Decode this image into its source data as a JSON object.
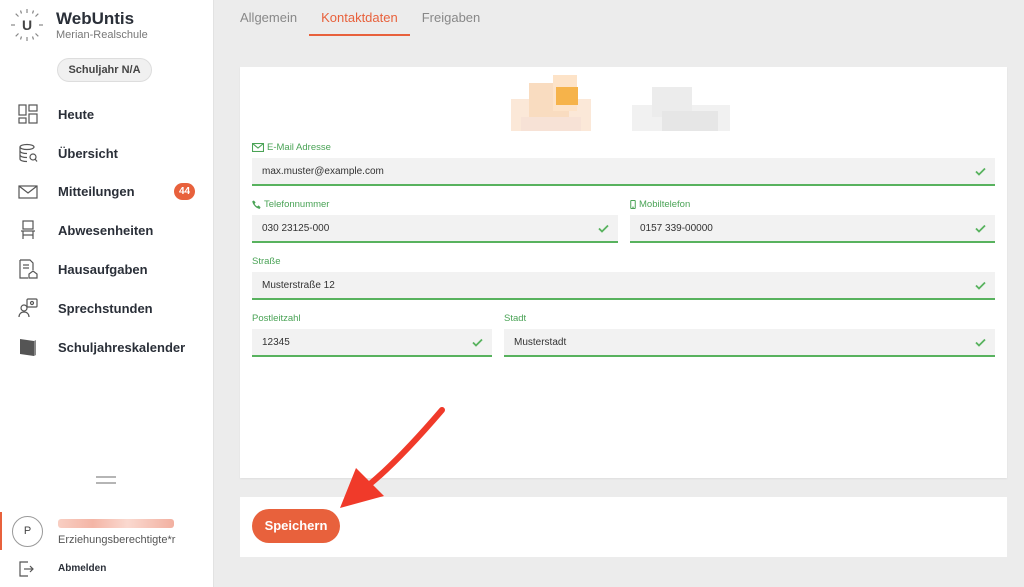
{
  "app": {
    "title": "WebUntis",
    "school": "Merian-Realschule",
    "year": "Schuljahr N/A"
  },
  "nav": [
    {
      "label": "Heute",
      "icon": "dashboard-icon"
    },
    {
      "label": "Übersicht",
      "icon": "overview-icon"
    },
    {
      "label": "Mitteilungen",
      "icon": "mail-icon",
      "badge": "44"
    },
    {
      "label": "Abwesenheiten",
      "icon": "chair-icon"
    },
    {
      "label": "Hausaufgaben",
      "icon": "homework-icon"
    },
    {
      "label": "Sprechstunden",
      "icon": "consultation-icon"
    },
    {
      "label": "Schuljahreskalender",
      "icon": "calendar-icon"
    }
  ],
  "user": {
    "initial": "P",
    "role": "Erziehungsberechtigte*r",
    "logout": "Abmelden"
  },
  "tabs": [
    {
      "label": "Allgemein",
      "active": false
    },
    {
      "label": "Kontaktdaten",
      "active": true
    },
    {
      "label": "Freigaben",
      "active": false
    }
  ],
  "form": {
    "email": {
      "label": "E-Mail Adresse",
      "value": "max.muster@example.com"
    },
    "phone": {
      "label": "Telefonnummer",
      "value": "030 23125-000"
    },
    "mobile": {
      "label": "Mobiltelefon",
      "value": "0157 339-00000"
    },
    "street": {
      "label": "Straße",
      "value": "Musterstraße 12"
    },
    "zip": {
      "label": "Postleitzahl",
      "value": "12345"
    },
    "city": {
      "label": "Stadt",
      "value": "Musterstadt"
    }
  },
  "save_label": "Speichern",
  "colors": {
    "accent": "#e8613c",
    "valid": "#58b25e",
    "label": "#4aa356"
  }
}
